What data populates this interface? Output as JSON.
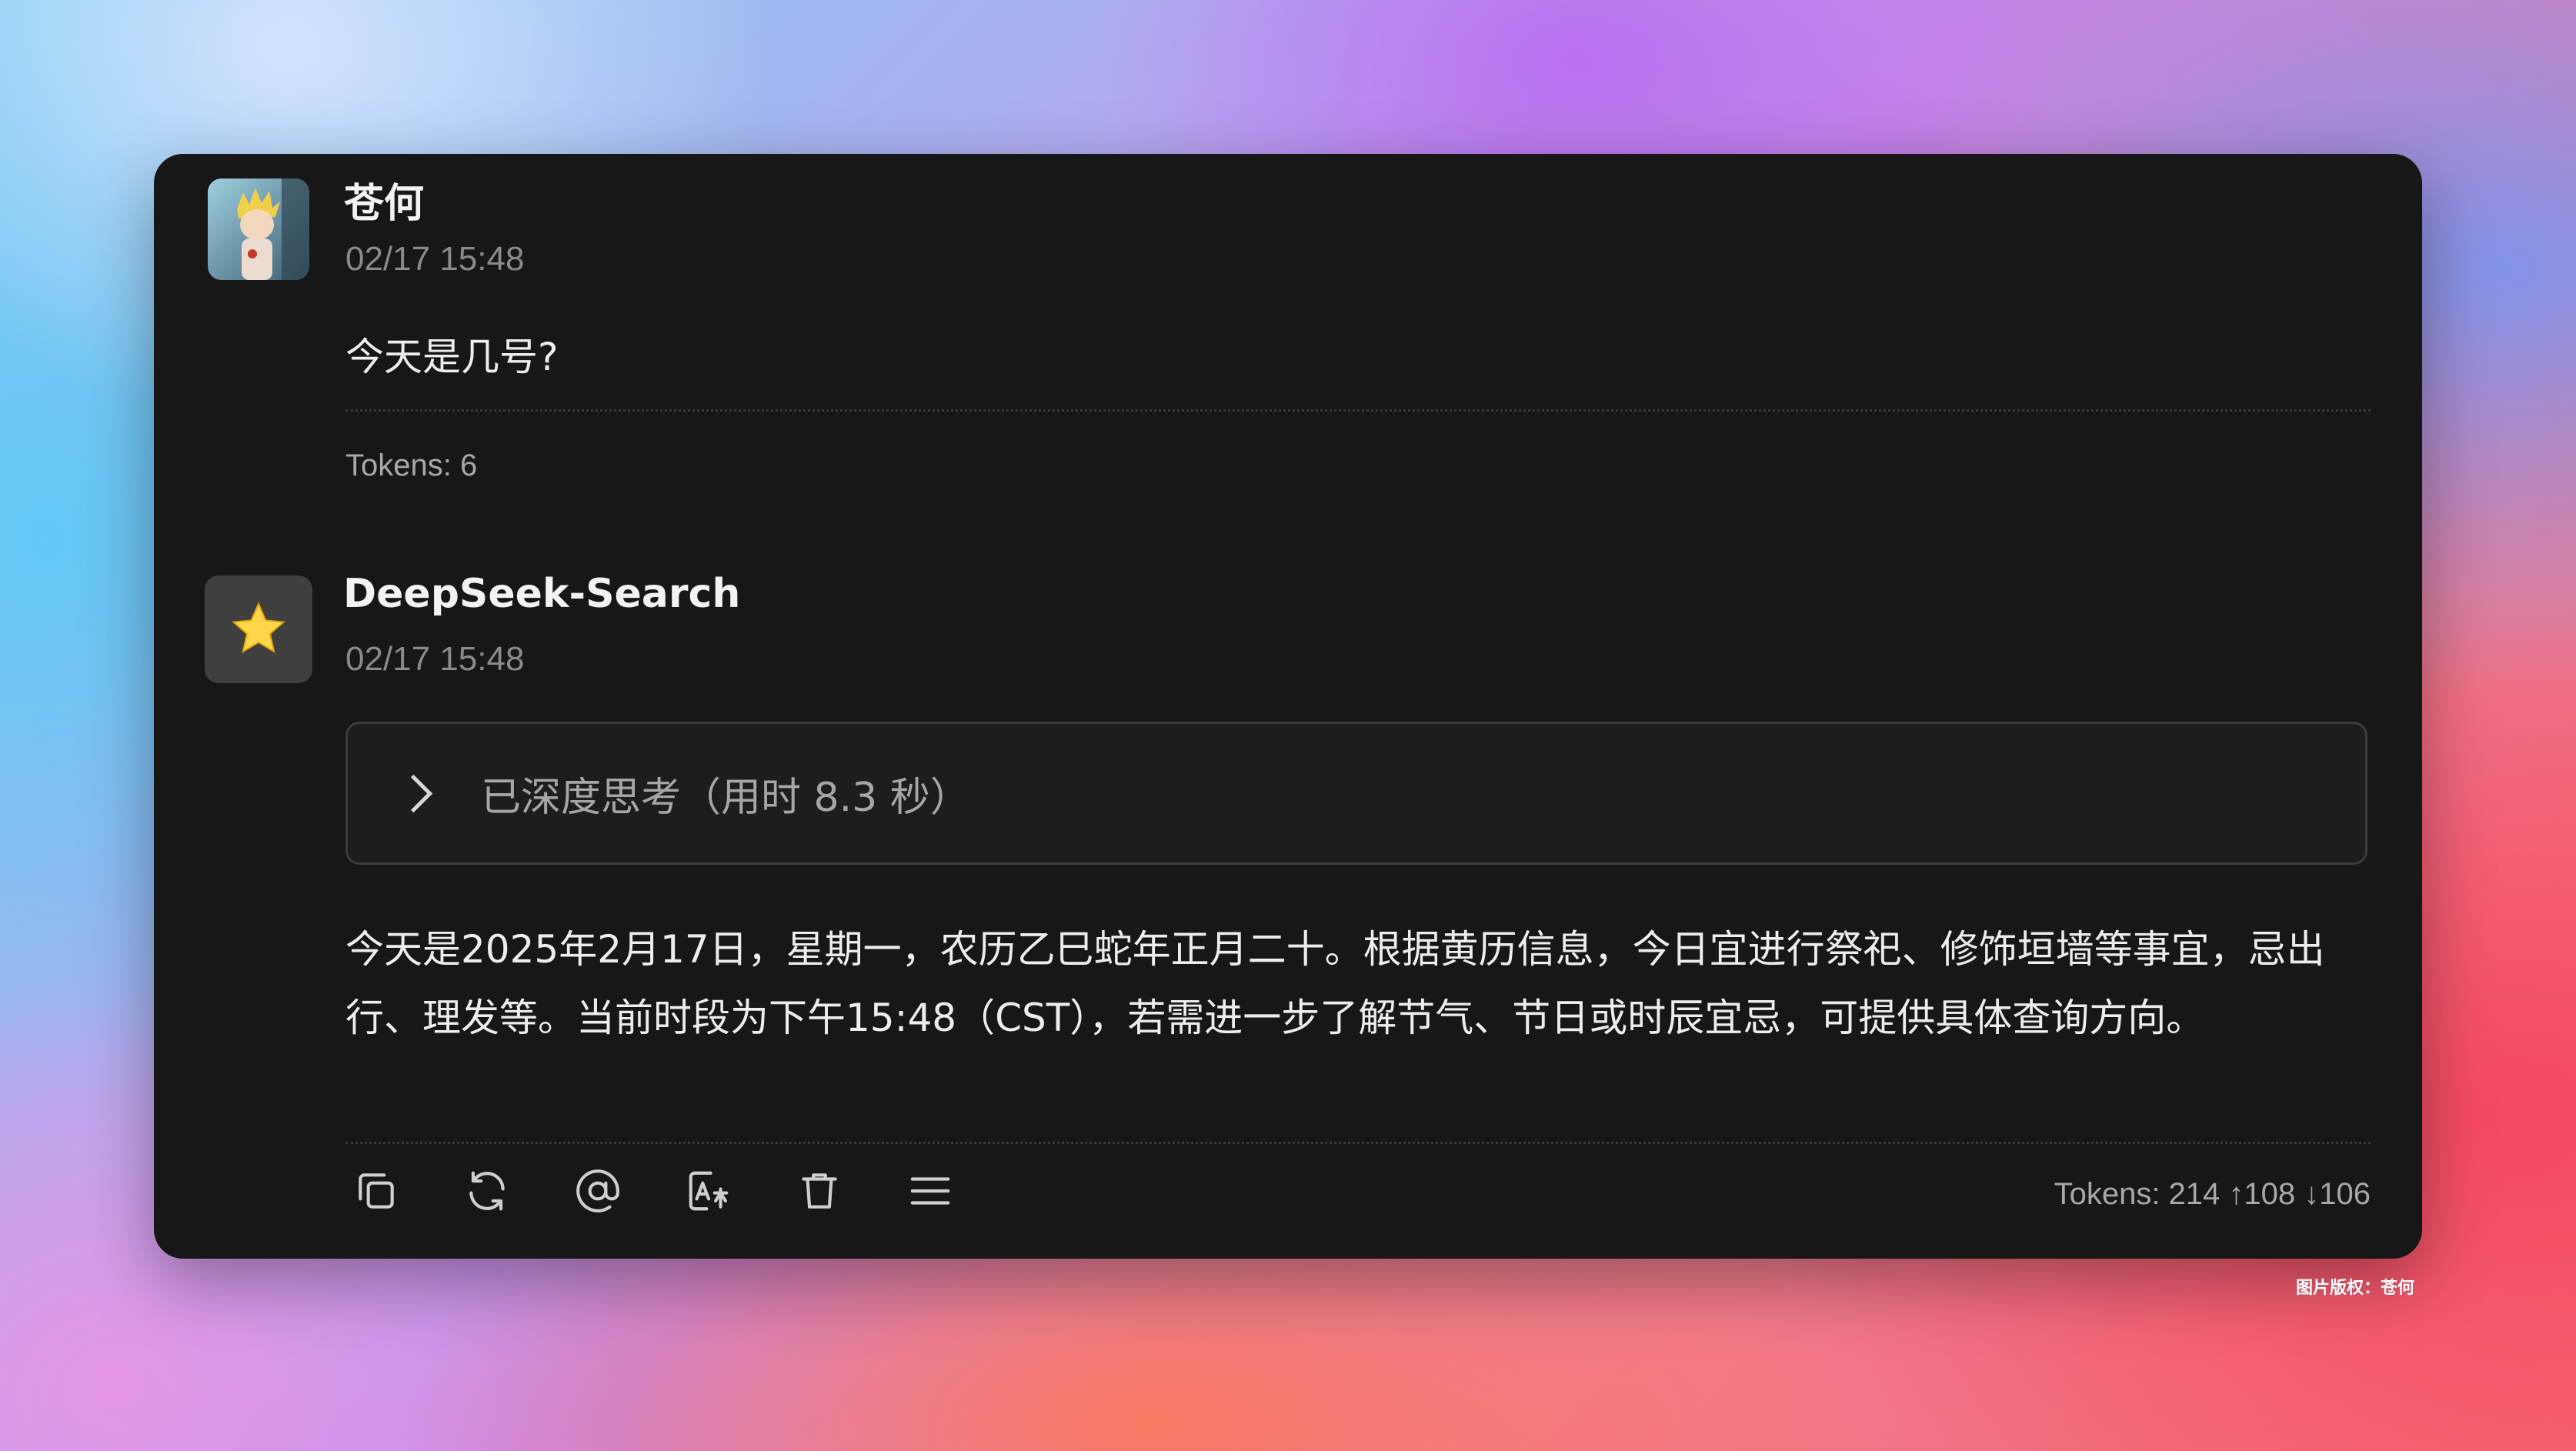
{
  "messages": [
    {
      "role": "user",
      "name": "苍何",
      "time": "02/17 15:48",
      "text": "今天是几号?",
      "tokens": "Tokens: 6"
    },
    {
      "role": "assistant",
      "name": "DeepSeek-Search",
      "time": "02/17 15:48",
      "avatar_icon": "star-icon",
      "thinking_label": "已深度思考（用时 8.3 秒）",
      "text": "今天是2025年2月17日，星期一，农历乙巳蛇年正月二十。根据黄历信息，今日宜进行祭祀、修饰垣墙等事宜，忌出行、理发等。当前时段为下午15:48（CST），若需进一步了解节气、节日或时辰宜忌，可提供具体查询方向。",
      "tokens": "Tokens: 214 ↑108 ↓106"
    }
  ],
  "toolbar": {
    "icons": [
      "copy-icon",
      "regenerate-icon",
      "mention-icon",
      "translate-icon",
      "delete-icon",
      "menu-icon"
    ]
  },
  "credit": "图片版权：苍何",
  "colors": {
    "card_bg": "#171717",
    "text": "#ededed",
    "muted": "#8b8b8b"
  }
}
